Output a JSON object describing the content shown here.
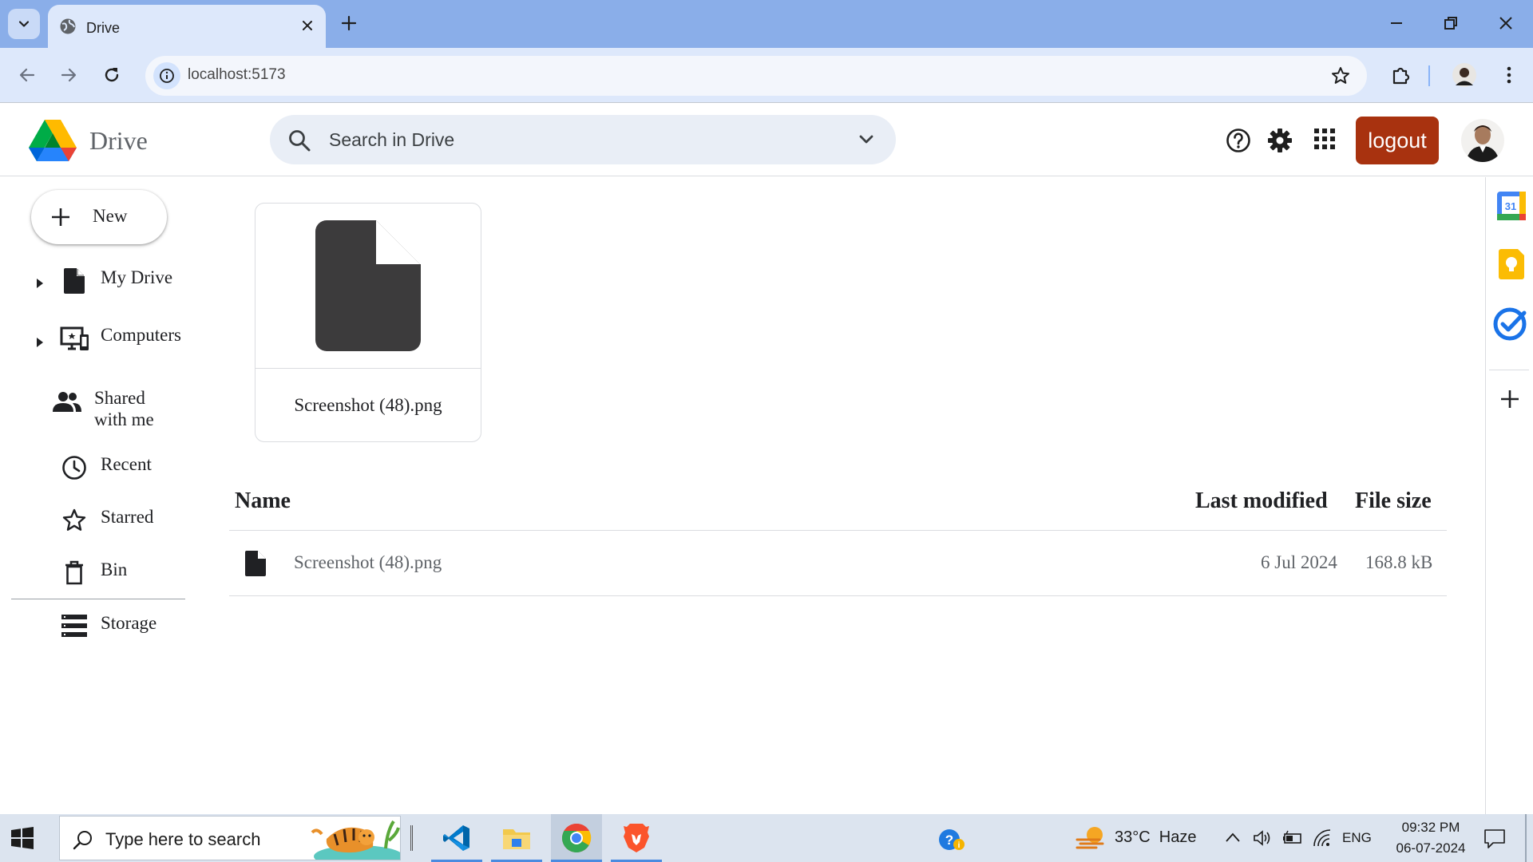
{
  "browser": {
    "tab_title": "Drive",
    "url": "localhost:5173"
  },
  "app": {
    "brand": "Drive",
    "search_placeholder": "Search in Drive",
    "logout_label": "logout"
  },
  "sidebar": {
    "new_label": "New",
    "items": [
      {
        "label": "My Drive",
        "icon": "file-icon",
        "expandable": true
      },
      {
        "label": "Computers",
        "icon": "computer-icon",
        "expandable": true
      },
      {
        "label_line1": "Shared",
        "label_line2": "with me",
        "icon": "people-icon",
        "expandable": false
      },
      {
        "label": "Recent",
        "icon": "clock-icon",
        "expandable": false
      },
      {
        "label": "Starred",
        "icon": "star-icon",
        "expandable": false
      },
      {
        "label": "Bin",
        "icon": "trash-icon",
        "expandable": false
      },
      {
        "label": "Storage",
        "icon": "storage-icon",
        "expandable": false
      }
    ]
  },
  "main": {
    "file_card": {
      "name": "Screenshot (48).png"
    },
    "table": {
      "columns": [
        "Name",
        "Last modified",
        "File size"
      ],
      "rows": [
        {
          "name": "Screenshot (48).png",
          "modified": "6 Jul 2024",
          "size": "168.8 kB"
        }
      ]
    }
  },
  "side_panel": {
    "calendar_day": "31"
  },
  "taskbar": {
    "search_placeholder": "Type here to search",
    "weather": "33°C  Haze",
    "language": "ENG",
    "time": "09:32 PM",
    "date": "06-07-2024"
  },
  "colors": {
    "tab_strip": "#8aaee9",
    "toolbar": "#dde8fb",
    "logout_bg": "#a8320f",
    "search_bg": "#e9eef6",
    "taskbar": "#dce4ef"
  }
}
